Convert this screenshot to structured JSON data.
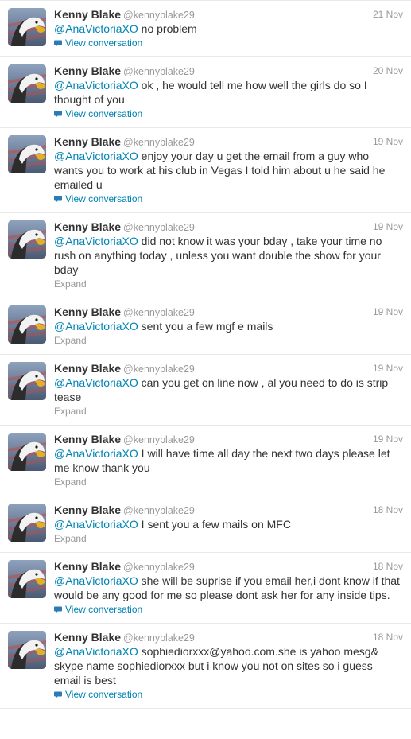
{
  "tweets": [
    {
      "name": "Kenny Blake",
      "handle": "@kennyblake29",
      "date": "21 Nov",
      "mention": "@AnaVictoriaXO",
      "text": " no problem",
      "action": "View conversation",
      "action_type": "conversation",
      "avatar_icon": "eagle-avatar-icon"
    },
    {
      "name": "Kenny Blake",
      "handle": "@kennyblake29",
      "date": "20 Nov",
      "mention": "@AnaVictoriaXO",
      "text": " ok , he would tell me how well the girls do so I thought of you",
      "action": "View conversation",
      "action_type": "conversation",
      "avatar_icon": "eagle-avatar-icon"
    },
    {
      "name": "Kenny Blake",
      "handle": "@kennyblake29",
      "date": "19 Nov",
      "mention": "@AnaVictoriaXO",
      "text": " enjoy your day u get the email from a guy who wants you to work at his club in Vegas I told him about u he said he emailed u",
      "action": "View conversation",
      "action_type": "conversation",
      "avatar_icon": "eagle-avatar-icon"
    },
    {
      "name": "Kenny Blake",
      "handle": "@kennyblake29",
      "date": "19 Nov",
      "mention": "@AnaVictoriaXO",
      "text": " did not know it was your bday , take your time no rush on anything today , unless you want double the show for your bday",
      "action": "Expand",
      "action_type": "expand",
      "avatar_icon": "eagle-avatar-icon"
    },
    {
      "name": "Kenny Blake",
      "handle": "@kennyblake29",
      "date": "19 Nov",
      "mention": "@AnaVictoriaXO",
      "text": " sent you a few mgf e mails",
      "action": "Expand",
      "action_type": "expand",
      "avatar_icon": "eagle-avatar-icon"
    },
    {
      "name": "Kenny Blake",
      "handle": "@kennyblake29",
      "date": "19 Nov",
      "mention": "@AnaVictoriaXO",
      "text": " can you get on line now , al you need to do is strip tease",
      "action": "Expand",
      "action_type": "expand",
      "avatar_icon": "eagle-avatar-icon"
    },
    {
      "name": "Kenny Blake",
      "handle": "@kennyblake29",
      "date": "19 Nov",
      "mention": "@AnaVictoriaXO",
      "text": " I will have time all day the next two days please let me know thank you",
      "action": "Expand",
      "action_type": "expand",
      "avatar_icon": "eagle-avatar-icon"
    },
    {
      "name": "Kenny Blake",
      "handle": "@kennyblake29",
      "date": "18 Nov",
      "mention": "@AnaVictoriaXO",
      "text": " I sent you a few mails on MFC",
      "action": "Expand",
      "action_type": "expand",
      "avatar_icon": "eagle-avatar-icon"
    },
    {
      "name": "Kenny Blake",
      "handle": "@kennyblake29",
      "date": "18 Nov",
      "mention": "@AnaVictoriaXO",
      "text": " she will be suprise if you email her,i dont know if that would be any good for me so please dont ask her for any inside tips.",
      "action": "View conversation",
      "action_type": "conversation",
      "avatar_icon": "eagle-avatar-icon"
    },
    {
      "name": "Kenny Blake",
      "handle": "@kennyblake29",
      "date": "18 Nov",
      "mention": "@AnaVictoriaXO",
      "text": " sophiediorxxx@yahoo.com.she is yahoo mesg& skype name sophiediorxxx but i know you not on sites so i guess email is best",
      "action": "View conversation",
      "action_type": "conversation",
      "avatar_icon": "eagle-avatar-icon"
    }
  ]
}
